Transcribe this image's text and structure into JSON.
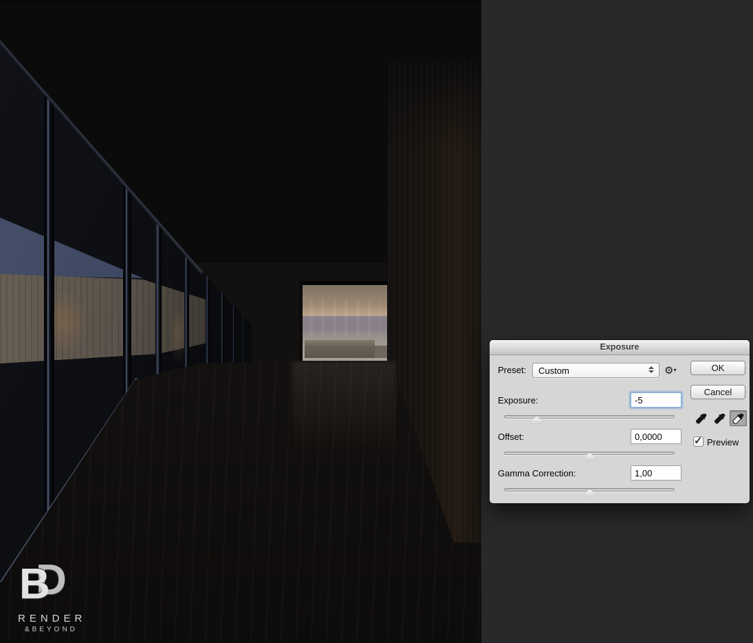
{
  "workspace": {
    "background_color": "#292929"
  },
  "photo": {
    "logo": {
      "monogram_front": "B",
      "monogram_back": "D",
      "line1": "RENDER",
      "line2": "&BEYOND"
    }
  },
  "dialog": {
    "title": "Exposure",
    "preset_label": "Preset:",
    "preset_value": "Custom",
    "gear_icon": "⚙",
    "gear_caret": "▾",
    "ok_label": "OK",
    "cancel_label": "Cancel",
    "fields": [
      {
        "label": "Exposure:",
        "value": "-5",
        "slider_percent": 19,
        "focused": true
      },
      {
        "label": "Offset:",
        "value": "0,0000",
        "slider_percent": 50,
        "focused": false
      },
      {
        "label": "Gamma Correction:",
        "value": "1,00",
        "slider_percent": 50,
        "focused": false
      }
    ],
    "eyedroppers": [
      {
        "name": "set-black-point",
        "selected": false
      },
      {
        "name": "set-gray-point",
        "selected": false
      },
      {
        "name": "set-white-point",
        "selected": true
      }
    ],
    "preview": {
      "label": "Preview",
      "checked": true,
      "check_glyph": "✓"
    },
    "colors": {
      "body": "#d6d6d6",
      "titlebar_top": "#f3f3f3",
      "titlebar_bottom": "#c3c3c3",
      "focus_ring": "#8ab2d8",
      "canvas": "#292929"
    }
  }
}
